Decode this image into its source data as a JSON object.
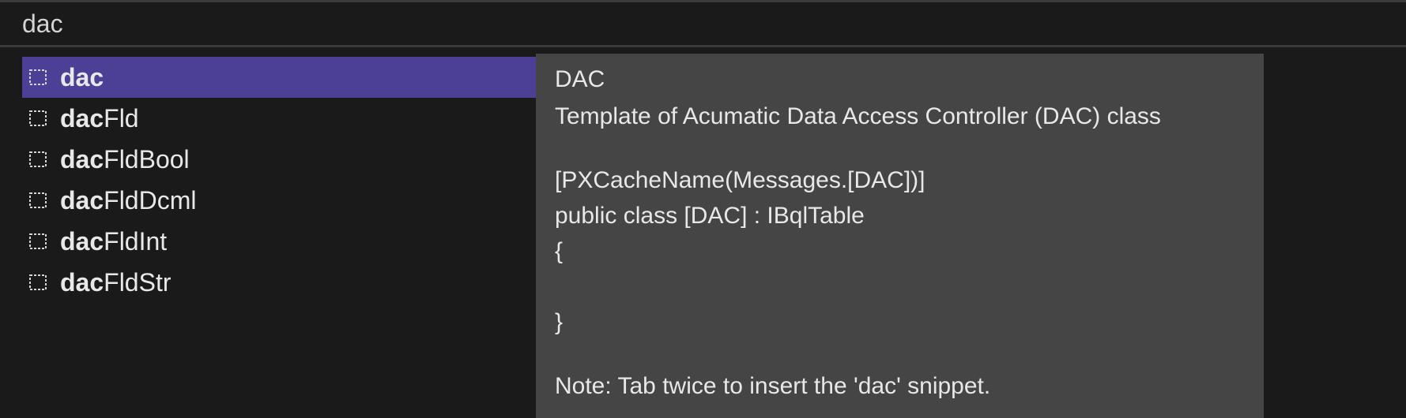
{
  "search": {
    "value": "dac"
  },
  "snippets": [
    {
      "bold": "dac",
      "normal": "",
      "selected": true
    },
    {
      "bold": "dac",
      "normal": "Fld",
      "selected": false
    },
    {
      "bold": "dac",
      "normal": "FldBool",
      "selected": false
    },
    {
      "bold": "dac",
      "normal": "FldDcml",
      "selected": false
    },
    {
      "bold": "dac",
      "normal": "FldInt",
      "selected": false
    },
    {
      "bold": "dac",
      "normal": "FldStr",
      "selected": false
    }
  ],
  "description": {
    "title": "DAC",
    "subtitle": "Template of Acumatic Data Access Controller (DAC) class",
    "code_line1": "[PXCacheName(Messages.[DAC])]",
    "code_line2": "public class [DAC] : IBqlTable",
    "code_line3": "{",
    "code_line4": "}",
    "note": "Note: Tab twice to insert the 'dac' snippet."
  }
}
